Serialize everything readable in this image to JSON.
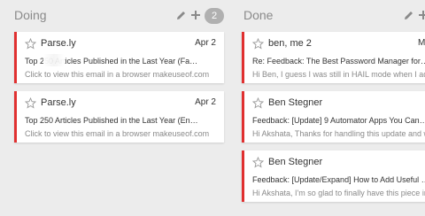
{
  "columns": [
    {
      "title": "Doing",
      "count": "2",
      "cards": [
        {
          "sender": "Parse.ly",
          "date": "Apr 2",
          "subject": "Top 250 Articles Published in the Last Year (Fa…",
          "preview": "Click to view this email in a browser makeuseof.com"
        },
        {
          "sender": "Parse.ly",
          "date": "Apr 2",
          "subject": "Top 250 Articles Published in the Last Year (En…",
          "preview": "Click to view this email in a browser makeuseof.com"
        }
      ]
    },
    {
      "title": "Done",
      "cards": [
        {
          "sender": "ben, me 2",
          "date": "M",
          "subject": "Re: Feedback: The Best Password Manager for…",
          "preview": "Hi Ben, I guess I was still in HAIL mode when I add"
        },
        {
          "sender": "Ben Stegner",
          "date": "",
          "subject": "Feedback: [Update] 9 Automator Apps You Can…",
          "preview": "Hi Akshata, Thanks for handling this update and wit"
        },
        {
          "sender": "Ben Stegner",
          "date": "",
          "subject": "Feedback: [Update/Expand] How to Add Useful …",
          "preview": "Hi Akshata, I'm so glad to finally have this piece in."
        }
      ]
    }
  ],
  "colors": {
    "accent": "#e03030",
    "badge": "#b0b0b0",
    "background": "#ececec"
  }
}
